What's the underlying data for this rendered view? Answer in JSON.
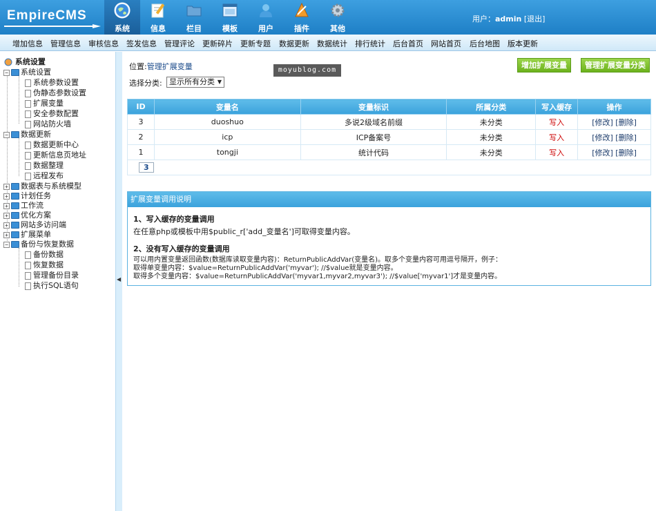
{
  "header": {
    "logo_text": "EmpireCMS",
    "nav": [
      {
        "label": "系统",
        "icon": "globe-icon",
        "active": true
      },
      {
        "label": "信息",
        "icon": "edit-icon"
      },
      {
        "label": "栏目",
        "icon": "folder-icon"
      },
      {
        "label": "模板",
        "icon": "template-icon"
      },
      {
        "label": "用户",
        "icon": "user-icon"
      },
      {
        "label": "插件",
        "icon": "plugin-icon"
      },
      {
        "label": "其他",
        "icon": "gear-icon"
      }
    ],
    "user_label": "用户：",
    "username": "admin",
    "logout": "[退出]"
  },
  "submenu": [
    "增加信息",
    "管理信息",
    "审核信息",
    "签发信息",
    "管理评论",
    "更新碎片",
    "更新专题",
    "数据更新",
    "数据统计",
    "排行统计",
    "后台首页",
    "网站首页",
    "后台地图",
    "版本更新"
  ],
  "sidebar": {
    "root": "系统设置",
    "groups": [
      {
        "label": "系统设置",
        "expanded": true,
        "items": [
          "系统参数设置",
          "伪静态参数设置",
          "扩展变量",
          "安全参数配置",
          "网站防火墙"
        ]
      },
      {
        "label": "数据更新",
        "expanded": true,
        "items": [
          "数据更新中心",
          "更新信息页地址",
          "数据整理",
          "远程发布"
        ]
      },
      {
        "label": "数据表与系统模型",
        "expanded": false,
        "items": []
      },
      {
        "label": "计划任务",
        "expanded": false,
        "items": []
      },
      {
        "label": "工作流",
        "expanded": false,
        "items": []
      },
      {
        "label": "优化方案",
        "expanded": false,
        "items": []
      },
      {
        "label": "网站多访问端",
        "expanded": false,
        "items": []
      },
      {
        "label": "扩展菜单",
        "expanded": false,
        "items": []
      },
      {
        "label": "备份与恢复数据",
        "expanded": true,
        "items": [
          "备份数据",
          "恢复数据",
          "管理备份目录",
          "执行SQL语句"
        ]
      }
    ]
  },
  "main": {
    "position_label": "位置:",
    "position_link": "管理扩展变量",
    "watermark": "moyublog.com",
    "btn_add": "增加扩展变量",
    "btn_manage": "管理扩展变量分类",
    "filter_label": "选择分类:",
    "filter_value": "显示所有分类",
    "table": {
      "headers": [
        "ID",
        "变量名",
        "变量标识",
        "所属分类",
        "写入缓存",
        "操作"
      ],
      "rows": [
        [
          "3",
          "duoshuo",
          "多说2级域名前缀",
          "未分类",
          "写入",
          "[修改] [删除]"
        ],
        [
          "2",
          "icp",
          "ICP备案号",
          "未分类",
          "写入",
          "[修改] [删除]"
        ],
        [
          "1",
          "tongji",
          "统计代码",
          "未分类",
          "写入",
          "[修改] [删除]"
        ]
      ],
      "page": "3"
    },
    "help": {
      "title": "扩展变量调用说明",
      "s1_title": "1、写入缓存的变量调用",
      "s1_text": "在任意php或模板中用$public_r['add_变量名']可取得变量内容。",
      "s2_title": "2、没有写入缓存的变量调用",
      "s2_line1": "可以用内置变量返回函数(数据库读取变量内容)：ReturnPublicAddVar(变量名)。取多个变量内容可用逗号隔开，例子：",
      "s2_line2": "取得单变量内容：$value=ReturnPublicAddVar('myvar'); //$value就是变量内容。",
      "s2_line3": "取得多个变量内容：$value=ReturnPublicAddVar('myvar1,myvar2,myvar3'); //$value['myvar1']才是变量内容。"
    }
  }
}
